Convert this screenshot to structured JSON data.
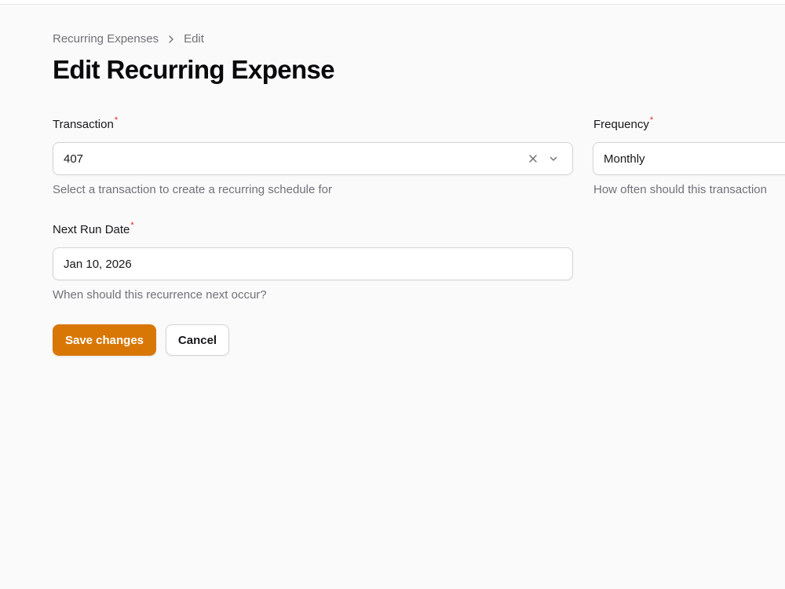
{
  "breadcrumb": {
    "parent": "Recurring Expenses",
    "current": "Edit"
  },
  "page": {
    "title": "Edit Recurring Expense"
  },
  "form": {
    "transaction": {
      "label": "Transaction",
      "required_mark": "*",
      "value": "407",
      "hint": "Select a transaction to create a recurring schedule for"
    },
    "frequency": {
      "label": "Frequency",
      "required_mark": "*",
      "value": "Monthly",
      "hint": "How often should this transaction"
    },
    "next_run_date": {
      "label": "Next Run Date",
      "required_mark": "*",
      "value": "Jan 10, 2026",
      "hint": "When should this recurrence next occur?"
    }
  },
  "actions": {
    "save_label": "Save changes",
    "cancel_label": "Cancel"
  },
  "colors": {
    "accent": "#d97706",
    "required": "#dc2626",
    "muted_text": "#71717a",
    "border": "#d4d4d8",
    "background": "#fafafa"
  },
  "icons": {
    "breadcrumb_separator": "chevron-right-icon",
    "clear": "close-icon",
    "dropdown": "chevron-down-icon"
  }
}
